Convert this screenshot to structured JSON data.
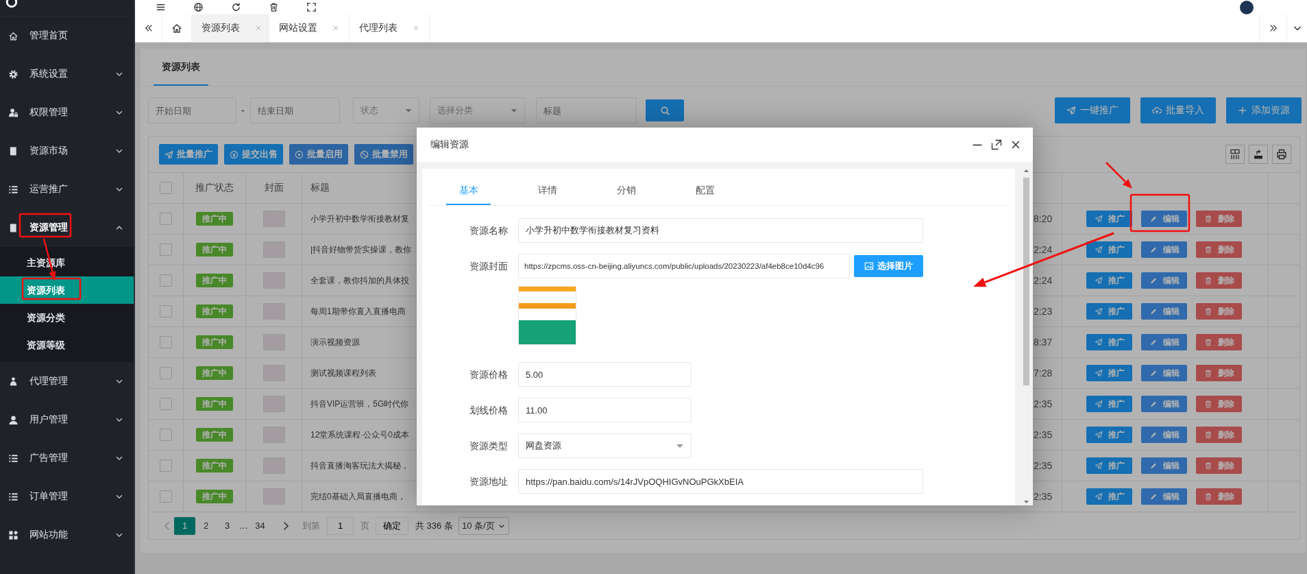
{
  "tabs": [
    {
      "label": "资源列表",
      "selected": true
    },
    {
      "label": "网站设置",
      "selected": false
    },
    {
      "label": "代理列表",
      "selected": false
    }
  ],
  "sidebar": {
    "items": [
      {
        "label": "管理首页",
        "kind": "link",
        "expanded": false
      },
      {
        "label": "系统设置",
        "kind": "menu",
        "expanded": false
      },
      {
        "label": "权限管理",
        "kind": "menu",
        "expanded": false
      },
      {
        "label": "资源市场",
        "kind": "menu",
        "expanded": false
      },
      {
        "label": "运营推广",
        "kind": "menu",
        "expanded": false
      },
      {
        "label": "资源管理",
        "kind": "menu",
        "expanded": true,
        "children": [
          {
            "label": "主资源库",
            "selected": false
          },
          {
            "label": "资源列表",
            "selected": true
          },
          {
            "label": "资源分类",
            "selected": false
          },
          {
            "label": "资源等级",
            "selected": false
          }
        ]
      },
      {
        "label": "代理管理",
        "kind": "menu",
        "expanded": false
      },
      {
        "label": "用户管理",
        "kind": "menu",
        "expanded": false
      },
      {
        "label": "广告管理",
        "kind": "menu",
        "expanded": false
      },
      {
        "label": "订单管理",
        "kind": "menu",
        "expanded": false
      },
      {
        "label": "网站功能",
        "kind": "menu",
        "expanded": false
      }
    ]
  },
  "page": {
    "title": "资源列表",
    "filters": [
      {
        "kind": "date",
        "placeholder": "开始日期"
      },
      {
        "kind": "separator",
        "text": "-"
      },
      {
        "kind": "date",
        "placeholder": "结束日期"
      },
      {
        "kind": "select",
        "placeholder": "状态"
      },
      {
        "kind": "select",
        "placeholder": "选择分类"
      },
      {
        "kind": "text",
        "placeholder": "标题"
      }
    ],
    "actions": [
      "一键推广",
      "批量导入",
      "添加资源"
    ]
  },
  "toolbar": [
    "批量推广",
    "提交出售",
    "批量启用",
    "批量禁用"
  ],
  "table": {
    "all_checked": false,
    "columns": [
      "推广状态",
      "封面",
      "标题"
    ],
    "rows": [
      {
        "checked": false,
        "status": "推广中",
        "title": "小学升初中数学衔接教材复",
        "column_5": "8:20",
        "actions": [
          "推广",
          "编辑",
          "删除"
        ]
      },
      {
        "checked": false,
        "status": "推广中",
        "title": "|抖音好物带货实操课，教你",
        "column_5": "2:24",
        "actions": [
          "推广",
          "编辑",
          "删除"
        ]
      },
      {
        "checked": false,
        "status": "推广中",
        "title": "全套课，教你抖加的具体投",
        "column_5": "2:24",
        "actions": [
          "推广",
          "编辑",
          "删除"
        ]
      },
      {
        "checked": false,
        "status": "推广中",
        "title": "每周1期带你直入直播电商",
        "column_5": "2:23",
        "actions": [
          "推广",
          "编辑",
          "删除"
        ]
      },
      {
        "checked": false,
        "status": "推广中",
        "title": "演示视频资源",
        "column_5": "8:37",
        "actions": [
          "推广",
          "编辑",
          "删除"
        ]
      },
      {
        "checked": false,
        "status": "推广中",
        "title": "测试视频课程列表",
        "column_5": "7:28",
        "actions": [
          "推广",
          "编辑",
          "删除"
        ]
      },
      {
        "checked": false,
        "status": "推广中",
        "title": "抖音VIP运营班，5G时代你",
        "column_5": "2:35",
        "actions": [
          "推广",
          "编辑",
          "删除"
        ]
      },
      {
        "checked": false,
        "status": "推广中",
        "title": "12堂系统课程·公众号0成本",
        "column_5": "2:35",
        "actions": [
          "推广",
          "编辑",
          "删除"
        ]
      },
      {
        "checked": false,
        "status": "推广中",
        "title": "抖音直播淘客玩法大揭秘，",
        "column_5": "2:35",
        "actions": [
          "推广",
          "编辑",
          "删除"
        ]
      },
      {
        "checked": false,
        "status": "推广中",
        "title": "完结0基础入局直播电商，",
        "column_5": "2:35",
        "actions": [
          "推广",
          "编辑",
          "删除"
        ]
      }
    ]
  },
  "pagination": {
    "prev": {
      "disabled": true
    },
    "pages": [
      {
        "label": "1",
        "selected": true
      },
      {
        "label": "2",
        "selected": false
      },
      {
        "label": "3",
        "selected": false
      }
    ],
    "ellipsis": "…",
    "last_page": {
      "label": "34",
      "selected": false
    },
    "next": {
      "disabled": false
    },
    "goto_label": "到第",
    "goto_value": "1",
    "page_unit": "页",
    "confirm": "确定",
    "total": "共 336 条",
    "page_size": "10 条/页"
  },
  "modal": {
    "title": "编辑资源",
    "tabs": [
      {
        "label": "基本",
        "selected": true
      },
      {
        "label": "详情",
        "selected": false
      },
      {
        "label": "分销",
        "selected": false
      },
      {
        "label": "配置",
        "selected": false
      }
    ],
    "fields": [
      {
        "label": "资源名称",
        "kind": "text",
        "value": "小学升初中数学衔接教材复习资料"
      },
      {
        "label": "资源封面",
        "kind": "image",
        "value": "https://zpcms.oss-cn-beijing.aliyuncs.com/public/uploads/20230223/af4eb8ce10d4c96",
        "button": "选择图片"
      },
      {
        "label": "资源价格",
        "kind": "short",
        "value": "5.00"
      },
      {
        "label": "划线价格",
        "kind": "short",
        "value": "11.00"
      },
      {
        "label": "资源类型",
        "kind": "select",
        "value": "网盘资源"
      },
      {
        "label": "资源地址",
        "kind": "text",
        "value": "https://pan.baidu.com/s/14rJVpOQHIGvNOuPGkXbEIA"
      }
    ]
  }
}
